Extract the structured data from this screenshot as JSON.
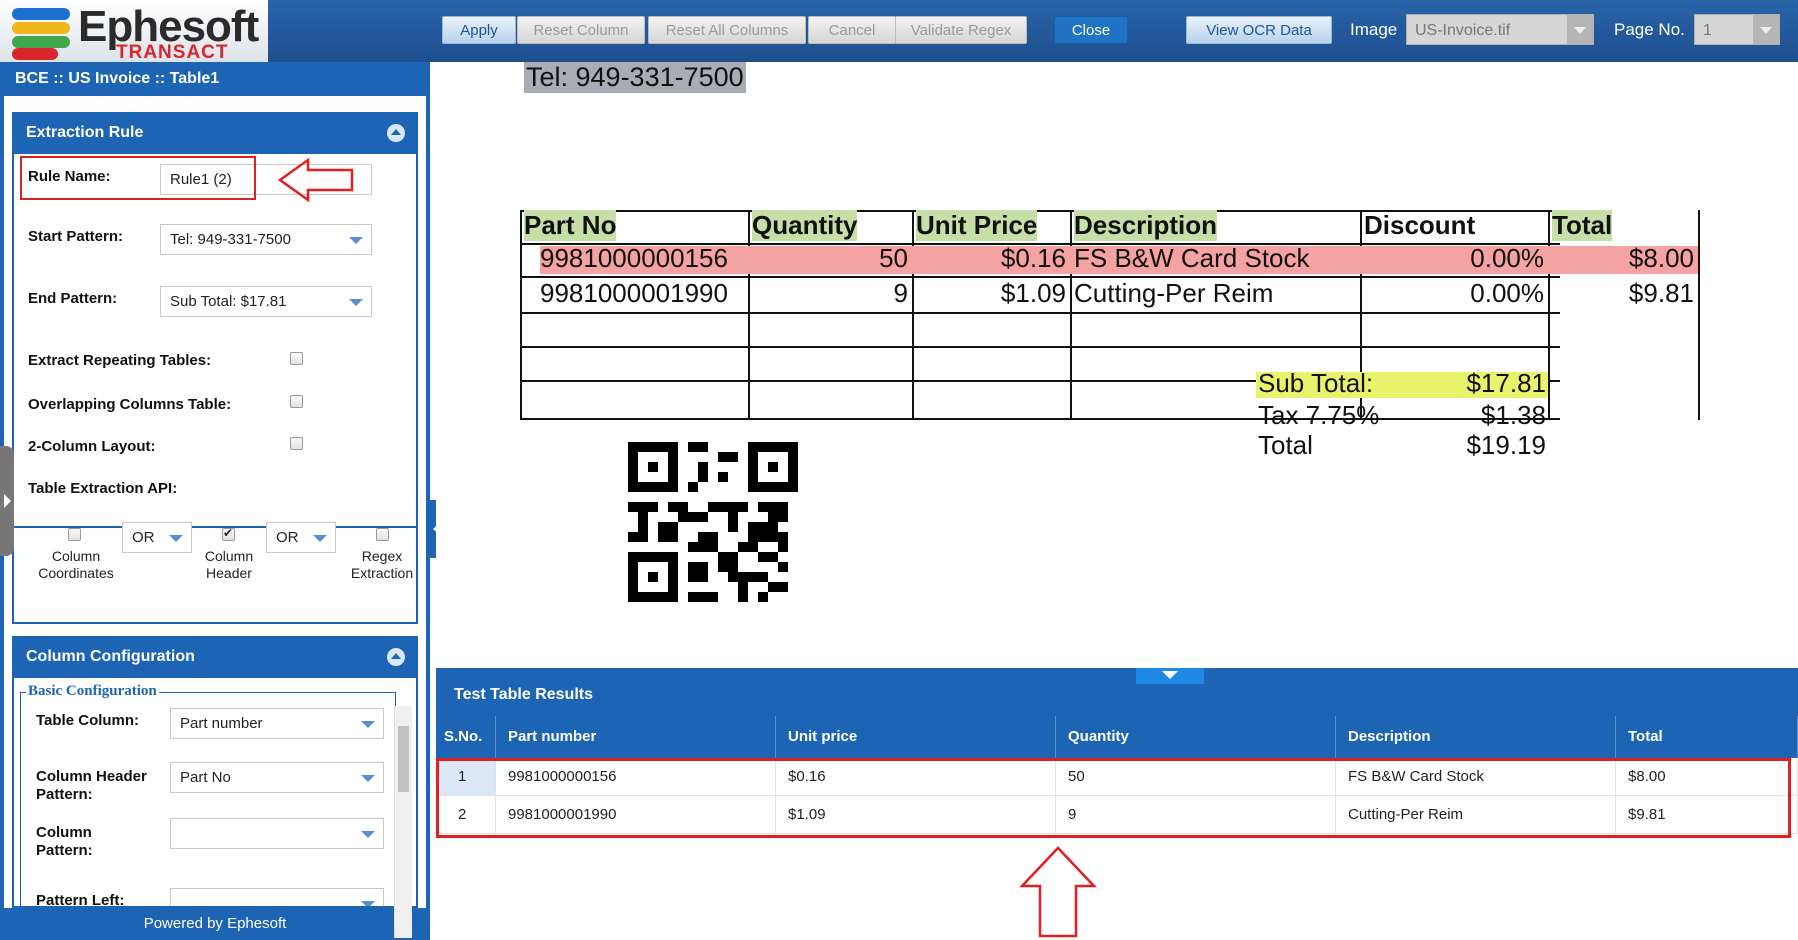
{
  "app": {
    "logo_word": "Ephesoft",
    "logo_sub": "TRANSACT",
    "breadcrumb": "BCE :: US Invoice :: Table1",
    "powered_by": "Powered by Ephesoft"
  },
  "toolbar": {
    "apply": "Apply",
    "reset_column": "Reset Column",
    "reset_all_columns": "Reset All Columns",
    "cancel": "Cancel",
    "validate_regex": "Validate Regex",
    "close": "Close",
    "view_ocr_data": "View OCR Data",
    "image_label": "Image",
    "image_value": "US-Invoice.tif",
    "page_label": "Page No.",
    "page_value": "1"
  },
  "extraction_rule": {
    "title": "Extraction Rule",
    "rule_name_label": "Rule Name:",
    "rule_name_value": "Rule1 (2)",
    "start_pattern_label": "Start Pattern:",
    "start_pattern_value": "Tel: 949-331-7500",
    "end_pattern_label": "End Pattern:",
    "end_pattern_value": "Sub Total: $17.81",
    "repeating_label": "Extract Repeating Tables:",
    "overlapping_label": "Overlapping Columns Table:",
    "two_column_label": "2-Column Layout:",
    "api_label": "Table Extraction API:",
    "api_or_1": "OR",
    "api_or_2": "OR",
    "api_col_coords": [
      "Column",
      "Coordinates"
    ],
    "api_col_header": [
      "Column",
      "Header"
    ],
    "api_regex": [
      "Regex",
      "Extraction"
    ],
    "api_checked": {
      "column_coordinates": false,
      "column_header": true,
      "regex_extraction": false
    }
  },
  "column_config": {
    "title": "Column Configuration",
    "basic_legend": "Basic Configuration",
    "table_column_label": "Table Column:",
    "table_column_value": "Part number",
    "header_pattern_label": [
      "Column Header",
      "Pattern:"
    ],
    "header_pattern_value": "Part No",
    "column_pattern_label": [
      "Column",
      "Pattern:"
    ],
    "column_pattern_value": "",
    "pattern_left_label": "Pattern Left:"
  },
  "document": {
    "tel": "Tel: 949-331-7500",
    "headers": [
      "Part No",
      "Quantity",
      "Unit Price",
      "Description",
      "Discount",
      "Total"
    ],
    "rows": [
      [
        "9981000000156",
        "50",
        "$0.16",
        "FS B&W Card Stock",
        "0.00%",
        "$8.00"
      ],
      [
        "9981000001990",
        "9",
        "$1.09",
        "Cutting-Per Reim",
        "0.00%",
        "$9.81"
      ]
    ],
    "subtotal_label": "Sub Total:",
    "subtotal_value": "$17.81",
    "tax_label": "Tax 7.75%",
    "tax_value": "$1.38",
    "total_label": "Total",
    "total_value": "$19.19"
  },
  "results": {
    "title": "Test Table Results",
    "columns": [
      "S.No.",
      "Part number",
      "Unit price",
      "Quantity",
      "Description",
      "Total"
    ],
    "rows": [
      [
        "1",
        "9981000000156",
        "$0.16",
        "50",
        "FS B&W Card Stock",
        "$8.00"
      ],
      [
        "2",
        "9981000001990",
        "$1.09",
        "9",
        "Cutting-Per Reim",
        "$9.81"
      ]
    ]
  },
  "colors": {
    "brand_blue": "#1e64b4",
    "annotation_red": "#e02020",
    "highlight_red": "#f4a2a2",
    "highlight_green": "#c5dfa7",
    "highlight_yellow": "#e8f26b"
  }
}
